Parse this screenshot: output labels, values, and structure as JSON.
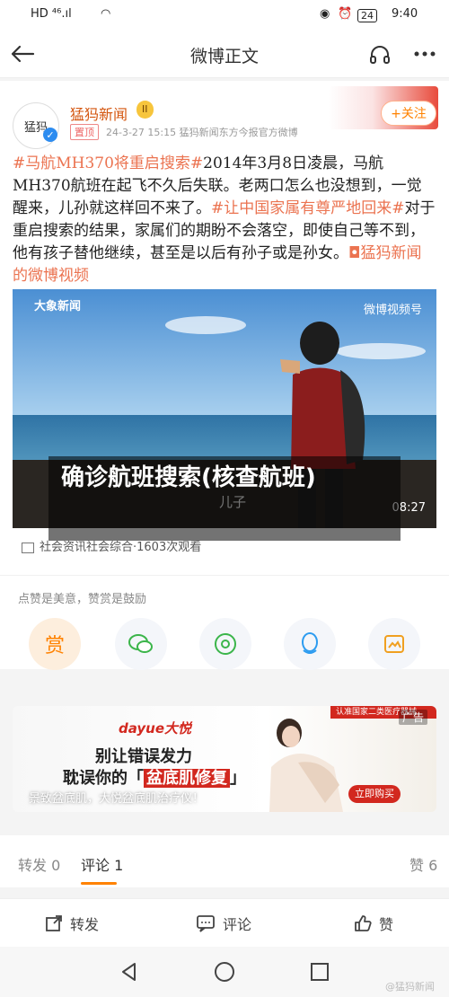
{
  "status_bar": {
    "left": "HD ⁴⁶.ıl",
    "battery": "24",
    "time": "9:40"
  },
  "nav": {
    "title": "微博正文",
    "back_icon": "back-arrow-icon",
    "headphones_icon": "headphones-icon",
    "more_icon": "more-icon"
  },
  "post": {
    "author": "猛犸新闻",
    "badge": "II",
    "source_tag": "置顶",
    "meta": "24-3-27 15:15  猛犸新闻东方今报官方微博",
    "follow_label": "+关注",
    "avatar_text": "猛犸",
    "hashtag1": "#马航MH370将重启搜索#",
    "body1": "2014年3月8日凌晨，马航MH370航班在起飞不久后失联。老两口怎么也没想到，一觉醒来，儿孙就这样回不来了。",
    "hashtag2": "#让中国家属有尊严地回来#",
    "body2": "对于重启搜索的结果，家属们的期盼不会落空，即使自己等不到，他有孩子替他继续，甚至是以后有孙子或是孙女。",
    "video_link": "◘猛犸新闻的微博视频",
    "video_logo_left": "大象新闻",
    "video_logo_right": "微博视频号",
    "video_caption": "儿子",
    "duration": "08:27",
    "overlay_title": "确诊航班搜索(核查航班)",
    "video_info": "社会资讯社会综合·1603次观看"
  },
  "reward": {
    "caption": "点赞是美意，赞赏是鼓励",
    "reward_label": "赏"
  },
  "ad": {
    "brand": "dayue大悦",
    "line1": "别让错误发力",
    "line2_prefix": "耽误你的「",
    "line2_highlight": "盆底肌修复",
    "line2_suffix": "」",
    "tagline": "景致盆底肌，大悦盆底肌治疗仪！",
    "ribbon": "认准国家二类医疗器械",
    "ad_tag": "广告",
    "buy_label": "立即购买"
  },
  "tabs": {
    "repost": "转发 0",
    "comments": "评论 1",
    "likes": "赞 6"
  },
  "actions": {
    "repost": "转发",
    "comment": "评论",
    "like": "赞"
  },
  "watermark": "@猛犸新闻",
  "colors": {
    "accent": "#ff8200",
    "author": "#d4550e",
    "hashtag": "#eb7350"
  }
}
